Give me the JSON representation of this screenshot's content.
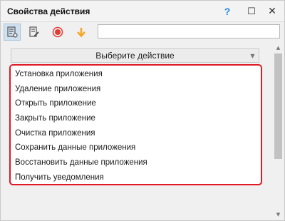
{
  "window": {
    "title": "Свойства действия",
    "help_glyph": "?",
    "maximize_glyph": "☐",
    "close_glyph": "✕"
  },
  "toolbar": {
    "icons": [
      "properties-icon",
      "edit-icon",
      "record-icon",
      "arrow-down-icon"
    ],
    "search": {
      "value": "",
      "placeholder": ""
    }
  },
  "action_select": {
    "selected": "Выберите действие",
    "arrow_glyph": "▼"
  },
  "actions": [
    "Установка приложения",
    "Удаление приложения",
    "Открыть приложение",
    "Закрыть приложение",
    "Очистка приложения",
    "Сохранить данные приложения",
    "Восстановить данные приложения",
    "Получить уведомления"
  ],
  "scrollbar": {
    "up_glyph": "▲",
    "down_glyph": "▼"
  },
  "colors": {
    "highlight_border": "#e01924",
    "record": "#e53935",
    "arrow": "#f5a623",
    "help": "#1e88e5",
    "active_tool": "#cfe0ee"
  }
}
